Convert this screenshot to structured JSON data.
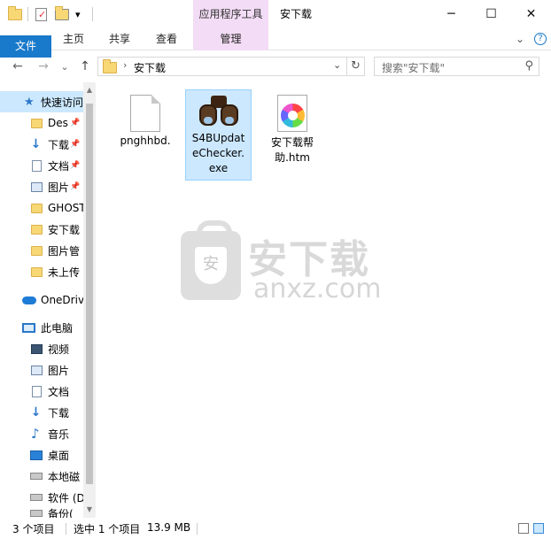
{
  "window": {
    "title": "安下载",
    "context_tab": "应用程序工具",
    "controls": {
      "minimize": "─",
      "maximize": "☐",
      "close": "✕"
    }
  },
  "quick_access_toolbar": {
    "dropdown": "▾"
  },
  "ribbon": {
    "tabs": [
      "文件",
      "主页",
      "共享",
      "查看",
      "管理"
    ],
    "collapse": "⌄",
    "help": "?"
  },
  "address": {
    "back": "←",
    "forward": "→",
    "recent": "⌄",
    "up": "↑",
    "separator": "›",
    "path": "安下载",
    "dropdown": "⌄",
    "refresh": "↻"
  },
  "search": {
    "placeholder": "搜索\"安下载\"",
    "icon": "⚲"
  },
  "nav_pane": {
    "items": [
      {
        "label": "快速访问",
        "icon": "star-icon",
        "pinned": false
      },
      {
        "label": "Des",
        "icon": "folder-icon",
        "pinned": true
      },
      {
        "label": "下载",
        "icon": "download-icon",
        "pinned": true
      },
      {
        "label": "文档",
        "icon": "document-icon",
        "pinned": true
      },
      {
        "label": "图片",
        "icon": "picture-icon",
        "pinned": true
      },
      {
        "label": "GHOST",
        "icon": "folder-icon",
        "pinned": false
      },
      {
        "label": "安下载",
        "icon": "folder-icon",
        "pinned": false
      },
      {
        "label": "图片管",
        "icon": "folder-icon",
        "pinned": false
      },
      {
        "label": "未上传",
        "icon": "folder-icon",
        "pinned": false
      },
      {
        "label": "OneDriv",
        "icon": "cloud-icon",
        "pinned": false
      },
      {
        "label": "此电脑",
        "icon": "computer-icon",
        "pinned": false
      },
      {
        "label": "视频",
        "icon": "video-icon",
        "pinned": false
      },
      {
        "label": "图片",
        "icon": "picture-icon",
        "pinned": false
      },
      {
        "label": "文档",
        "icon": "document-icon",
        "pinned": false
      },
      {
        "label": "下载",
        "icon": "download-icon",
        "pinned": false
      },
      {
        "label": "音乐",
        "icon": "music-icon",
        "pinned": false
      },
      {
        "label": "桌面",
        "icon": "desktop-icon",
        "pinned": false
      },
      {
        "label": "本地磁",
        "icon": "drive-icon",
        "pinned": false
      },
      {
        "label": "软件 (D",
        "icon": "drive-icon",
        "pinned": false
      },
      {
        "label": "备份(",
        "icon": "drive-icon",
        "pinned": false
      }
    ]
  },
  "files": [
    {
      "name": "pnghhbd.",
      "icon": "blank-file-icon",
      "selected": false
    },
    {
      "name": "S4BUpdateChecker.exe",
      "icon": "binoculars-icon",
      "selected": true
    },
    {
      "name": "安下载帮助.htm",
      "icon": "htm-file-icon",
      "selected": false
    }
  ],
  "watermark": {
    "cn": "安下载",
    "en": "anxz.com",
    "seal": "安"
  },
  "status": {
    "count": "3 个项目",
    "selection": "选中 1 个项目",
    "size": "13.9 MB"
  }
}
